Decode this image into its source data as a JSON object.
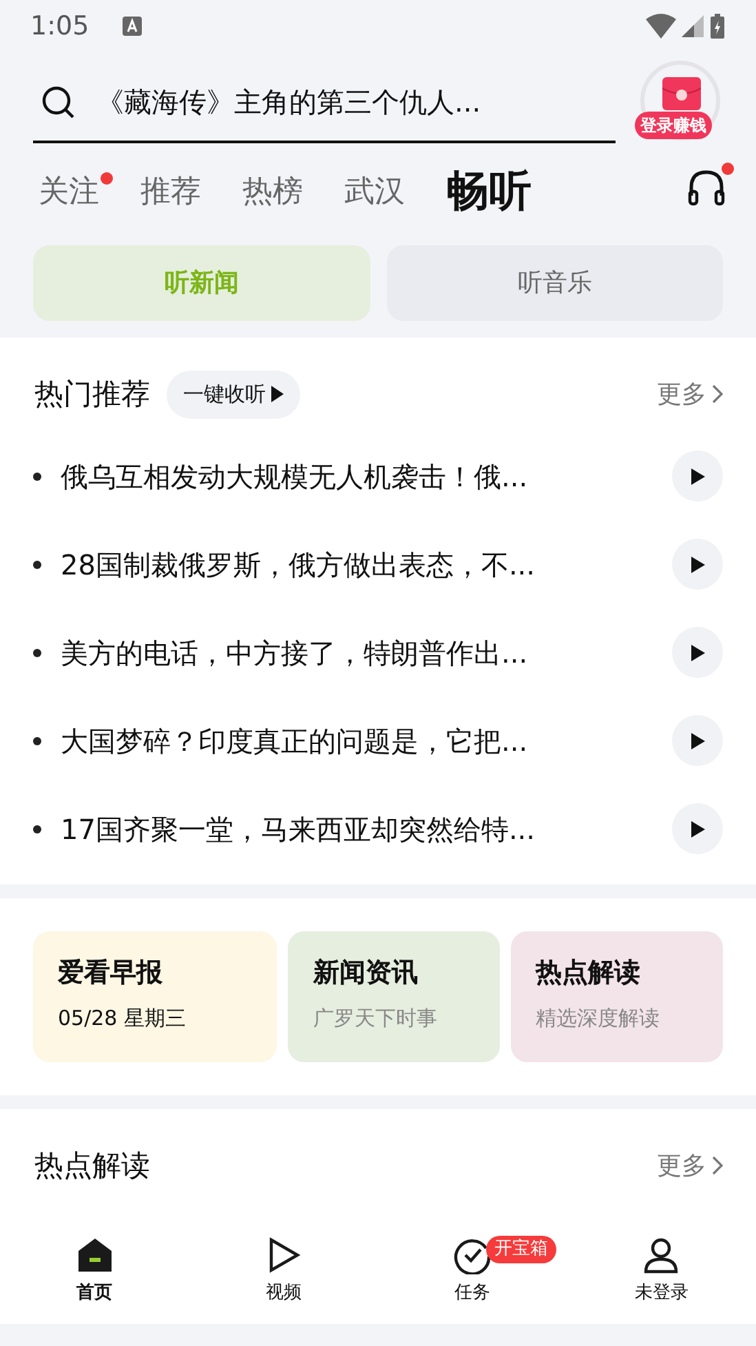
{
  "status_bar": {
    "time": "1:05"
  },
  "search": {
    "value": "《藏海传》主角的第三个仇人..."
  },
  "login_badge": {
    "label": "登录赚钱"
  },
  "tabs": [
    {
      "label": "关注",
      "selected": false,
      "dot": true
    },
    {
      "label": "推荐",
      "selected": false,
      "dot": false
    },
    {
      "label": "热榜",
      "selected": false,
      "dot": false
    },
    {
      "label": "武汉",
      "selected": false,
      "dot": false
    },
    {
      "label": "畅听",
      "selected": true,
      "dot": false
    }
  ],
  "headphones": {
    "dot": true
  },
  "sub_tabs": [
    {
      "label": "听新闻",
      "selected": true
    },
    {
      "label": "听音乐",
      "selected": false
    }
  ],
  "hot": {
    "title": "热门推荐",
    "play_all": "一键收听",
    "more": "更多",
    "items": [
      "俄乌互相发动大规模无人机袭击！俄...",
      "28国制裁俄罗斯，俄方做出表态，不...",
      "美方的电话，中方接了，特朗普作出...",
      "大国梦碎？印度真正的问题是，它把...",
      "17国齐聚一堂，马来西亚却突然给特..."
    ]
  },
  "cards": [
    {
      "title": "爱看早报",
      "subtitle": "05/28 星期三",
      "color": "#fdf7e4"
    },
    {
      "title": "新闻资讯",
      "subtitle": "广罗天下时事",
      "color": "#e6eedf"
    },
    {
      "title": "热点解读",
      "subtitle": "精选深度解读",
      "color": "#f3e4ea"
    }
  ],
  "hot_read": {
    "title": "热点解读",
    "more": "更多"
  },
  "bottom_nav": [
    {
      "label": "首页",
      "kind": "home",
      "selected": true
    },
    {
      "label": "视频",
      "kind": "play",
      "selected": false
    },
    {
      "label": "任务",
      "kind": "task",
      "selected": false,
      "badge": "开宝箱"
    },
    {
      "label": "未登录",
      "kind": "user",
      "selected": false
    }
  ]
}
